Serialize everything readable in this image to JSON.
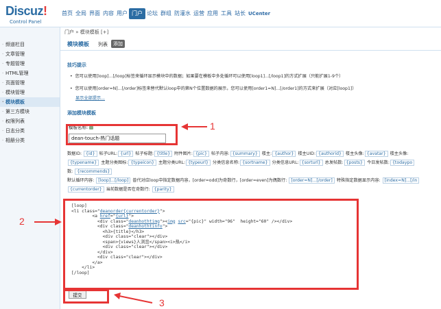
{
  "logo": {
    "main": "Discuz",
    "excl": "!",
    "sub": "Control Panel"
  },
  "topnav": [
    "首页",
    "全局",
    "界面",
    "内容",
    "用户",
    "门户",
    "论坛",
    "群组",
    "防灌水",
    "运营",
    "应用",
    "工具",
    "站长",
    "UCenter"
  ],
  "topnav_active": "门户",
  "sidebar": {
    "items": [
      "频道栏目",
      "文章管理",
      "专题管理",
      "HTML管理",
      "页面管理",
      "模块管理",
      "模块模板",
      "第三方模块",
      "权限列表",
      "日志分类",
      "相册分类"
    ],
    "active": "模块模板"
  },
  "breadcrumb": "门户 » 模块模板  [+]",
  "tabs": {
    "title": "模块模板",
    "list": "列表",
    "add": "添加"
  },
  "tips": {
    "title": "技巧提示",
    "line1": "您可以使用[loop]...[/loop]标签来循环显示模块中的数据；如果要在模板中多处循环可以使用[loop1]...[/loop1]的方式扩展（只能扩展1-9个）",
    "line2": "您可以使用[order=N]...[/order]标签来替代默认loop中的第N个位置数据的展示，您可以使用[order1=N]...[/order1]的方式来扩展（对应[loop1]）",
    "more": "显示全部提示..."
  },
  "add": {
    "title": "添加模块模板",
    "name_label": "模板名称:",
    "name_value": "dean-touch-热门话题"
  },
  "vars": {
    "row1_prefix": "数据ID:",
    "row1": [
      {
        "label": "",
        "tag": "{id}"
      },
      {
        "label": "帖子URL:",
        "tag": "{url}"
      },
      {
        "label": "帖子标题:",
        "tag": "{title}"
      },
      {
        "label": "附件图片:",
        "tag": "{pic}"
      },
      {
        "label": "帖子内容:",
        "tag": "{summary}"
      },
      {
        "label": "楼主:",
        "tag": "{author}"
      },
      {
        "label": "楼主UID:",
        "tag": "{authorid}"
      },
      {
        "label": "楼主头像:",
        "tag": "{avatar}"
      },
      {
        "label": "楼主头像:",
        "tag": ""
      }
    ],
    "row2": [
      {
        "label": "",
        "tag": "{typename}"
      },
      {
        "label": "主题分类图标:",
        "tag": "{typeicon}"
      },
      {
        "label": "主题分类URL:",
        "tag": "{typeurl}"
      },
      {
        "label": "分类信息名称:",
        "tag": "{sortname}"
      },
      {
        "label": "分类信息URL:",
        "tag": "{sorturl}"
      },
      {
        "label": "总发帖数:",
        "tag": "{posts}"
      },
      {
        "label": "今日发帖数:",
        "tag": "{todaypo"
      }
    ],
    "row3_prefix": "数:",
    "row3_tag": "{recommends}",
    "row4_prefix": "默认循环内容:",
    "row4_tag1": "[loop]...[/loop]",
    "row4_mid": "普代对应loop中指定数据内容，[order=odd]为奇数行，[order=even]为偶数行:",
    "row4_tag2": "[order=N]...[/order]",
    "row4_mid2": "特殊指定数据显示内容:",
    "row4_tag3": "[index=N]...[/in",
    "row5_tag1": "{currentorder}",
    "row5_mid": "当前数据是否在奇数行:",
    "row5_tag2": "{parity}"
  },
  "code": {
    "l1": "[loop]",
    "l2a": "<li class=\"",
    "l2u": "deanorder{currentorder}",
    "l2b": "\">",
    "l3a": "        <a ",
    "l3u": "href",
    "l3b": "=\"",
    "l3u2": "{url}",
    "l3c": "\">",
    "l4a": "          <div class=\"",
    "l4u": "deanhothtimg",
    "l4b": "\"><",
    "l4u2": "img",
    "l4c": " ",
    "l4u3": "src",
    "l4d": "=\"{pic}\" width=\"96\"  height=\"60\" /></div>",
    "l5a": "          <div class=\"",
    "l5u": "deanhothtinfo",
    "l5b": "\">",
    "l6": "            <h3>{title}</h3>",
    "l7": "            <div class=\"clear\"></div>",
    "l8": "            <span>{views}人浏览</span><i>热</i>",
    "l9": "            <div class=\"clear\"></div>",
    "l10": "          </div>",
    "l11": "          <div class=\"clear\"></div>",
    "l12": "        </a>",
    "l13": "    </li>",
    "l14": "[/loop]"
  },
  "submit": "提交",
  "markers": [
    "1",
    "2",
    "3"
  ],
  "colors": {
    "accent": "#2b6ca3",
    "annotation": "#e63434"
  }
}
